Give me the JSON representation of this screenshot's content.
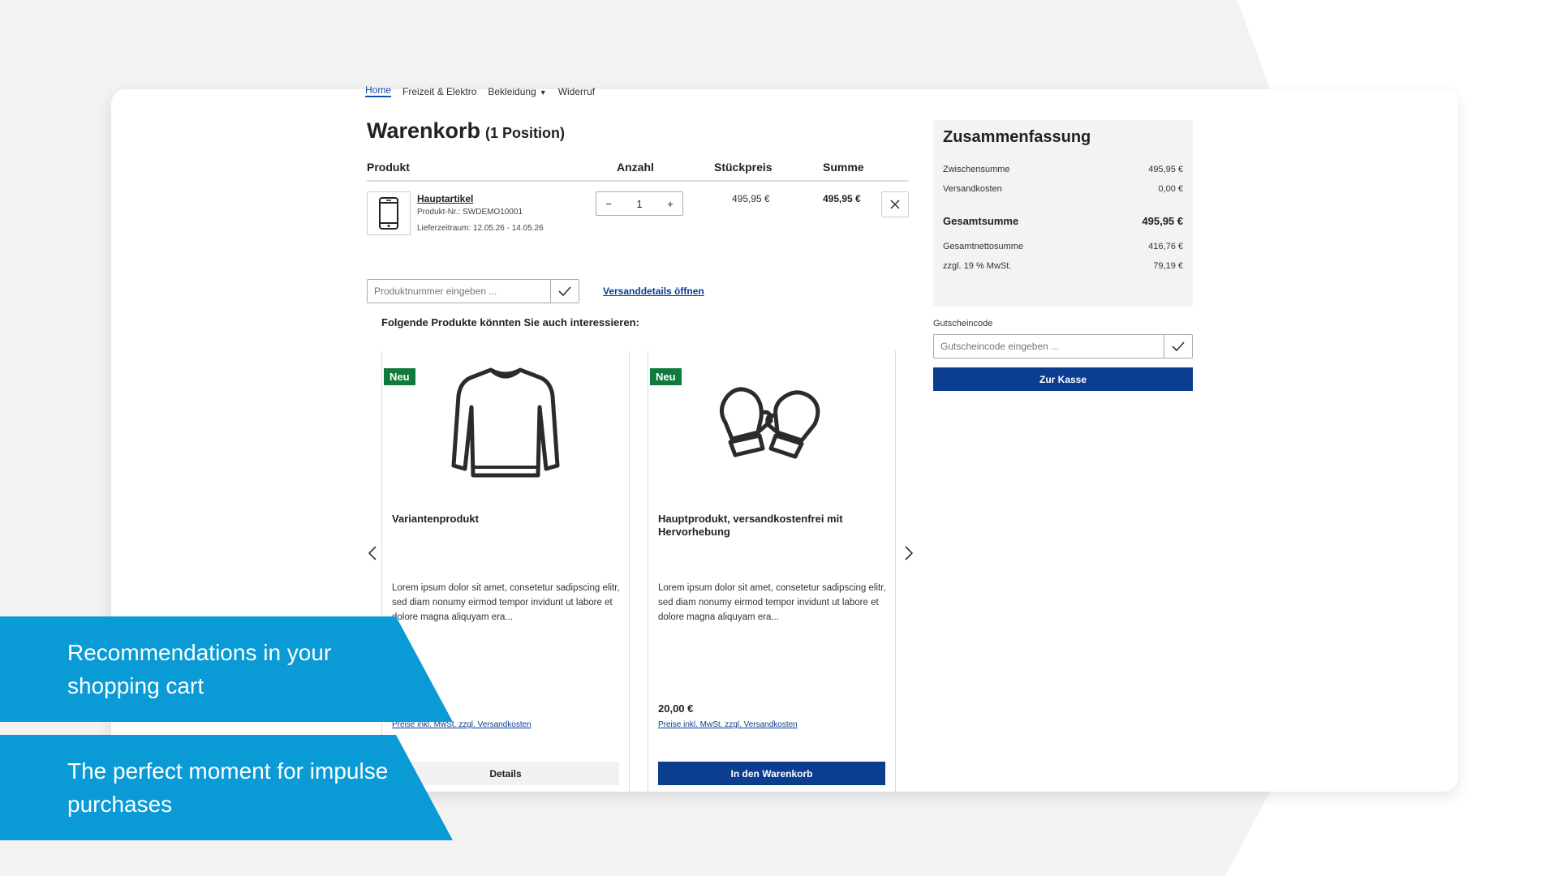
{
  "colors": {
    "brand_blue": "#0b3d91",
    "badge_green": "#0e7a3c",
    "banner_blue": "#0a9bd6",
    "background_gray": "#f2f2f2"
  },
  "nav": {
    "items": [
      "Home",
      "Freizeit & Elektro",
      "Bekleidung",
      "Widerruf"
    ],
    "active": "Home"
  },
  "cart": {
    "title": "Warenkorb",
    "position_count": "(1 Position)",
    "headers": {
      "product": "Produkt",
      "quantity": "Anzahl",
      "unit_price": "Stückpreis",
      "total": "Summe"
    },
    "item": {
      "icon": "smartphone-icon",
      "name": "Hauptartikel",
      "sku": "Produkt-Nr.: SWDEMO10001",
      "delivery": "Lieferzeitraum: 12.05.26 - 14.05.26",
      "quantity": "1",
      "unit_price": "495,95 €",
      "total": "495,95 €"
    },
    "product_number_placeholder": "Produktnummer eingeben ...",
    "shipping_link": "Versanddetails öffnen"
  },
  "recommendations": {
    "title": "Folgende Produkte könnten Sie auch interessieren:",
    "cards": [
      {
        "badge": "Neu",
        "icon": "sweater-icon",
        "name": "Variantenprodukt",
        "description": "Lorem ipsum dolor sit amet, consetetur sadipscing elitr, sed diam nonumy eirmod tempor invidunt ut labore et dolore magna aliquyam era...",
        "price": "",
        "price_note": "Preise inkl. MwSt. zzgl. Versandkosten",
        "button": "Details"
      },
      {
        "badge": "Neu",
        "icon": "mittens-icon",
        "name": "Hauptprodukt, versandkostenfrei mit Hervorhebung",
        "description": "Lorem ipsum dolor sit amet, consetetur sadipscing elitr, sed diam nonumy eirmod tempor invidunt ut labore et dolore magna aliquyam era...",
        "price": "20,00 €",
        "price_note": "Preise inkl. MwSt. zzgl. Versandkosten",
        "button": "In den Warenkorb"
      }
    ]
  },
  "summary": {
    "title": "Zusammenfassung",
    "subtotal_label": "Zwischensumme",
    "subtotal_value": "495,95 €",
    "shipping_label": "Versandkosten",
    "shipping_value": "0,00 €",
    "total_label": "Gesamtsumme",
    "total_value": "495,95 €",
    "net_label": "Gesamtnettosumme",
    "net_value": "416,76 €",
    "vat_label": "zzgl. 19 % MwSt.",
    "vat_value": "79,19 €",
    "voucher_label": "Gutscheincode",
    "voucher_placeholder": "Gutscheincode eingeben ...",
    "checkout_button": "Zur Kasse"
  },
  "banners": [
    "Recommendations in your shopping cart",
    "The perfect moment for impulse purchases"
  ]
}
